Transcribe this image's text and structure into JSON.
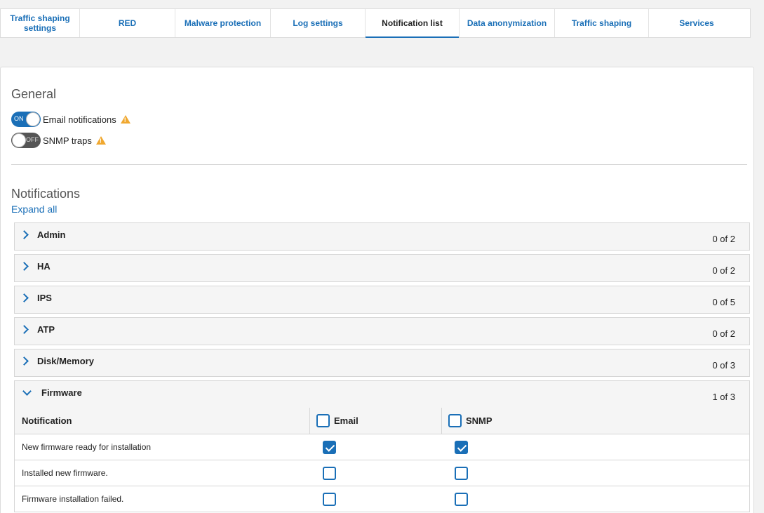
{
  "tabs": [
    {
      "label": "Traffic shaping settings"
    },
    {
      "label": "RED"
    },
    {
      "label": "Malware protection"
    },
    {
      "label": "Log settings"
    },
    {
      "label": "Notification list",
      "active": true
    },
    {
      "label": "Data anonymization"
    },
    {
      "label": "Traffic shaping"
    },
    {
      "label": "Services"
    }
  ],
  "general": {
    "title": "General",
    "email": {
      "state": "ON",
      "label": "Email notifications"
    },
    "snmp": {
      "state": "OFF",
      "label": "SNMP traps"
    }
  },
  "notifications": {
    "title": "Notifications",
    "expand_all": "Expand all",
    "groups": [
      {
        "name": "Admin",
        "count": "0 of 2"
      },
      {
        "name": "HA",
        "count": "0 of 2"
      },
      {
        "name": "IPS",
        "count": "0 of 5"
      },
      {
        "name": "ATP",
        "count": "0 of 2"
      },
      {
        "name": "Disk/Memory",
        "count": "0 of 3"
      },
      {
        "name": "Firmware",
        "count": "1 of 3",
        "expanded": true
      }
    ],
    "table": {
      "headers": {
        "notification": "Notification",
        "email": "Email",
        "snmp": "SNMP"
      },
      "rows": [
        {
          "label": "New firmware ready for installation",
          "email": true,
          "snmp": true
        },
        {
          "label": "Installed new firmware.",
          "email": false,
          "snmp": false
        },
        {
          "label": "Firmware installation failed.",
          "email": false,
          "snmp": false
        }
      ]
    }
  },
  "colors": {
    "accent": "#1a6fb7",
    "warning": "#f0a830"
  }
}
